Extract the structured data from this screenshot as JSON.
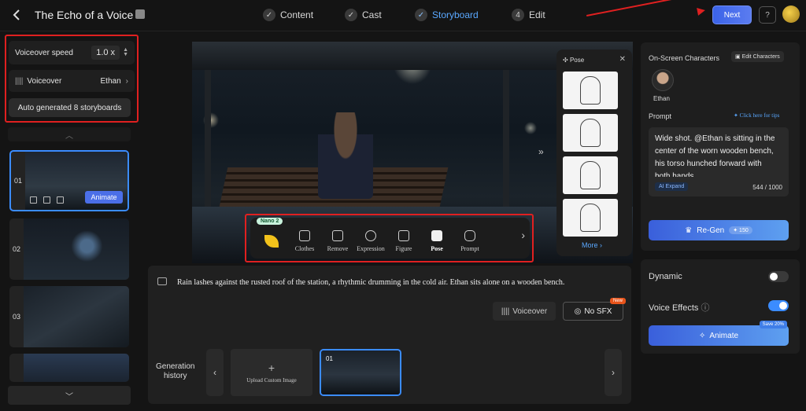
{
  "header": {
    "title": "The Echo of a Voice",
    "steps": [
      {
        "label": "Content",
        "marker": "✓"
      },
      {
        "label": "Cast",
        "marker": "✓"
      },
      {
        "label": "Storyboard",
        "marker": "✓"
      },
      {
        "label": "Edit",
        "marker": "4"
      }
    ],
    "next_label": "Next",
    "help_glyph": "?"
  },
  "left_panel": {
    "speed_label": "Voiceover speed",
    "speed_value": "1.0 x",
    "voiceover_label": "Voiceover",
    "voiceover_value": "Ethan",
    "auto_label": "Auto generated 8 storyboards",
    "thumbnails": [
      {
        "num": "01",
        "animate": "Animate"
      },
      {
        "num": "02"
      },
      {
        "num": "03"
      },
      {
        "num": ""
      }
    ]
  },
  "toolbar": {
    "badge": "Nano 2",
    "tools": [
      "Clothes",
      "Remove",
      "Expression",
      "Figure",
      "Pose",
      "Prompt"
    ],
    "selected": "Pose"
  },
  "pose_panel": {
    "title": "Pose",
    "more": "More"
  },
  "caption": {
    "text": "Rain lashes against the rusted roof of the station, a rhythmic drumming in the cold air. Ethan sits alone on a wooden bench.",
    "voiceover_btn": "Voiceover",
    "sfx_btn": "No SFX",
    "new_badge": "New"
  },
  "history": {
    "label_line1": "Generation",
    "label_line2": "history",
    "upload_label": "Upload Custom Image",
    "thumb_num": "01"
  },
  "right_panel": {
    "chars_title": "On-Screen Characters",
    "edit_chars": "Edit Characters",
    "char_name": "Ethan",
    "prompt_title": "Prompt",
    "tips": "Click here for tips",
    "prompt_text": "Wide shot. @Ethan is sitting in the center of the worn wooden bench, his torso hunched forward with both hands",
    "ai_expand": "AI Expand",
    "count": "544 / 1000",
    "regen": "Re-Gen",
    "regen_cost": "150",
    "dynamic_label": "Dynamic",
    "dynamic_on": false,
    "voice_effects_label": "Voice Effects",
    "voice_effects_on": true,
    "animate": "Animate",
    "save_badge": "Save 20%"
  },
  "colors": {
    "accent": "#3b8cff",
    "annotation": "#e02020"
  }
}
